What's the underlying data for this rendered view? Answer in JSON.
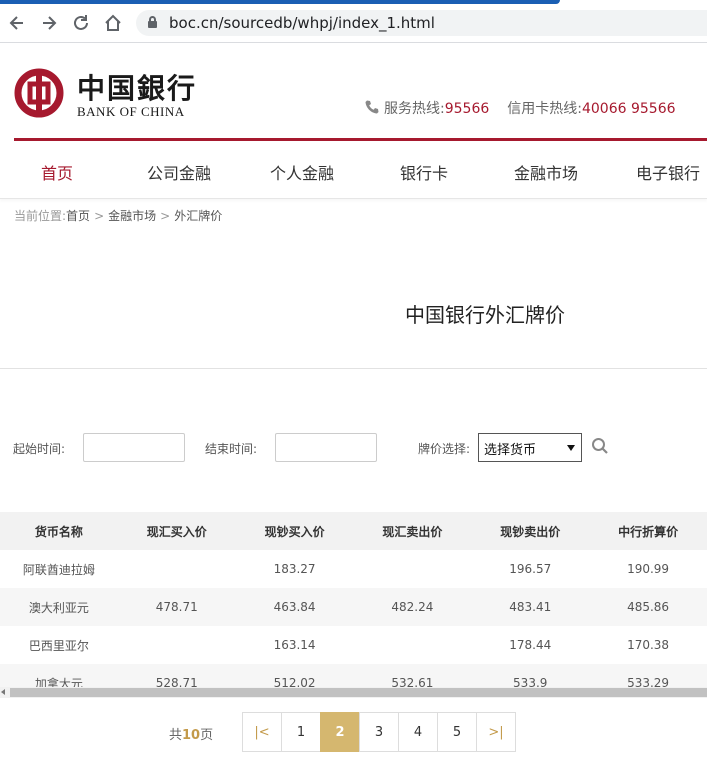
{
  "browser": {
    "url": "boc.cn/sourcedb/whpj/index_1.html",
    "nav_icons": [
      "back-arrow-icon",
      "forward-arrow-icon",
      "reload-icon",
      "home-icon"
    ]
  },
  "header": {
    "logo_cn": "中国銀行",
    "logo_en": "BANK OF CHINA",
    "service_label": "服务热线:",
    "service_number": "95566",
    "card_label": "信用卡热线:",
    "card_number": "40066 95566",
    "brand_color": "#a6192e"
  },
  "nav": {
    "items": [
      "首页",
      "公司金融",
      "个人金融",
      "银行卡",
      "金融市场",
      "电子银行"
    ],
    "active_index": 0
  },
  "breadcrumb": {
    "prefix": "当前位置:",
    "items": [
      "首页",
      "金融市场",
      "外汇牌价"
    ]
  },
  "page_title": "中国银行外汇牌价",
  "filters": {
    "start_label": "起始时间:",
    "start_value": "",
    "end_label": "结束时间:",
    "end_value": "",
    "currency_label": "牌价选择:",
    "currency_selected": "选择货币"
  },
  "table": {
    "headers": [
      "货币名称",
      "现汇买入价",
      "现钞买入价",
      "现汇卖出价",
      "现钞卖出价",
      "中行折算价"
    ],
    "rows": [
      [
        "阿联酋迪拉姆",
        "",
        "183.27",
        "",
        "196.57",
        "190.99"
      ],
      [
        "澳大利亚元",
        "478.71",
        "463.84",
        "482.24",
        "483.41",
        "485.86"
      ],
      [
        "巴西里亚尔",
        "",
        "163.14",
        "",
        "178.44",
        "170.38"
      ],
      [
        "加拿大元",
        "528.71",
        "512.02",
        "532.61",
        "533.9",
        "533.29"
      ]
    ]
  },
  "pagination": {
    "total_prefix": "共",
    "total_pages": "10",
    "total_suffix": "页",
    "first_symbol": "|<",
    "pages": [
      "1",
      "2",
      "3",
      "4",
      "5"
    ],
    "current": "2",
    "last_symbol": ">|"
  }
}
